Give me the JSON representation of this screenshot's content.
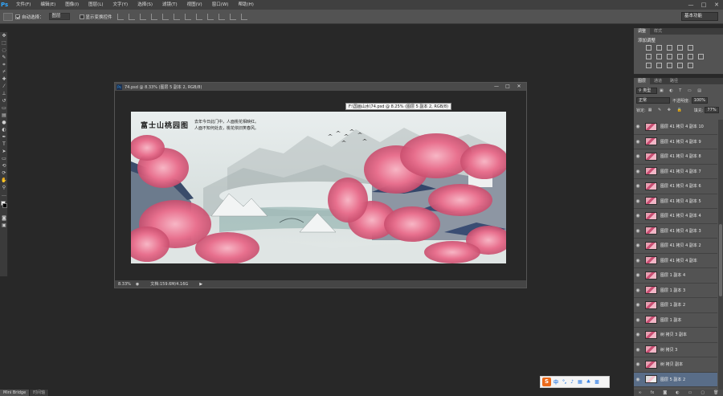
{
  "app": {
    "logo": "Ps"
  },
  "menu": [
    "文件(F)",
    "编辑(E)",
    "图像(I)",
    "图层(L)",
    "文字(Y)",
    "选择(S)",
    "滤镜(T)",
    "视图(V)",
    "窗口(W)",
    "帮助(H)"
  ],
  "window_controls": {
    "minimize": "—",
    "maximize": "□",
    "close": "✕"
  },
  "options": {
    "auto_select_label": "自动选择：",
    "auto_select_value": "图层",
    "show_transform_label": "显示变换控件",
    "workspace": "基本功能"
  },
  "document": {
    "title": "74.psd @ 8.33% (图层 5 副本 2, RGB/8)",
    "zoom": "8.33%",
    "doc_info": "文档:159.6M/4.16G",
    "tooltip": "F:\\国画山水\\74.psd @ 8.25% (图层 5 副本 2, RGB/8)"
  },
  "artwork": {
    "title": "富士山桃园图",
    "poem_line1": "去年今日此门中，人面桃花相映红。",
    "poem_line2": "人面不知何处去，桃花依旧笑春风。",
    "sky_color": "#dfe6e6",
    "blossom_color": "#e8708e"
  },
  "adjustments": {
    "tabs": [
      "调整",
      "样式"
    ],
    "title": "添加调整"
  },
  "layers": {
    "tabs": [
      "图层",
      "通道",
      "路径"
    ],
    "filter_label": "类型",
    "blend_mode": "正常",
    "opacity_label": "不透明度:",
    "opacity_value": "100%",
    "lock_label": "锁定:",
    "fill_label": "填充:",
    "fill_value": "77%",
    "items": [
      {
        "name": "图层 41 拷贝 4 副本 10",
        "thumb": "pink"
      },
      {
        "name": "图层 41 拷贝 4 副本 9",
        "thumb": "pink"
      },
      {
        "name": "图层 41 拷贝 4 副本 8",
        "thumb": "pink"
      },
      {
        "name": "图层 41 拷贝 4 副本 7",
        "thumb": "pink"
      },
      {
        "name": "图层 41 拷贝 4 副本 6",
        "thumb": "pink"
      },
      {
        "name": "图层 41 拷贝 4 副本 5",
        "thumb": "pink"
      },
      {
        "name": "图层 41 拷贝 4 副本 4",
        "thumb": "pink"
      },
      {
        "name": "图层 41 拷贝 4 副本 3",
        "thumb": "pink"
      },
      {
        "name": "图层 41 拷贝 4 副本 2",
        "thumb": "pink"
      },
      {
        "name": "图层 41 拷贝 4 副本",
        "thumb": "pink"
      },
      {
        "name": "图层 1 副本 4",
        "thumb": "pink"
      },
      {
        "name": "图层 1 副本 3",
        "thumb": "pink"
      },
      {
        "name": "图层 1 副本 2",
        "thumb": "pink"
      },
      {
        "name": "图层 1 副本",
        "thumb": "pink"
      },
      {
        "name": "树 拷贝 3 副本",
        "thumb": "pink"
      },
      {
        "name": "树 拷贝 3",
        "thumb": "pink"
      },
      {
        "name": "树 拷贝 副本",
        "thumb": "pink"
      },
      {
        "name": "图层 5 副本 2",
        "thumb": "white",
        "selected": true
      }
    ],
    "bottom_icons": [
      "link-icon",
      "fx-icon",
      "mask-icon",
      "adjustment-icon",
      "group-icon",
      "new-layer-icon",
      "trash-icon"
    ]
  },
  "bottom_tabs": [
    "Mini Bridge",
    "时间轴"
  ],
  "ime": {
    "logo": "S",
    "lang": "中"
  }
}
